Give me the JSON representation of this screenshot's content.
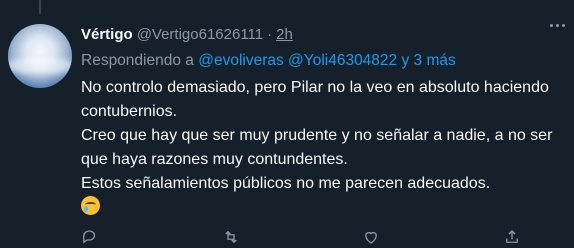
{
  "tweet": {
    "author_name": "Vértigo",
    "author_handle": "@Vertigo61626111",
    "separator": "·",
    "time": "2h",
    "replying_prefix": "Respondiendo a",
    "replying_to": [
      "@evoliveras",
      "@Yoli46304822"
    ],
    "replying_more": "y 3 más",
    "lines": [
      "No controlo demasiado, pero Pilar no la veo en absoluto haciendo contubernios.",
      "Creo que hay que ser muy prudente y no señalar a nadie, a no ser que haya razones muy contundentes.",
      "Estos señalamientos públicos no me parecen adecuados."
    ],
    "emoji_icon": "crying-face-icon"
  },
  "icons": {
    "avatar": "sky-clouds-avatar",
    "more": "more-options-icon",
    "actions": [
      "reply-icon",
      "retweet-icon",
      "like-icon",
      "share-icon"
    ]
  },
  "colors": {
    "background": "#15202b",
    "text_primary": "#f7f9f9",
    "text_secondary": "#8b98a5",
    "link": "#1d9bf0"
  }
}
